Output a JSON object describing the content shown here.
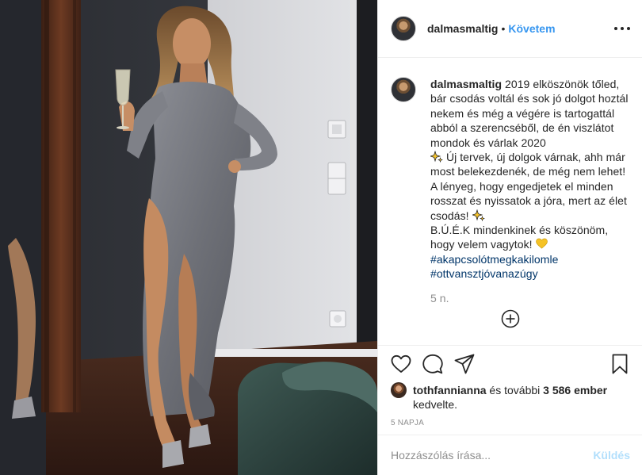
{
  "post": {
    "username": "dalmasmaltig",
    "follow_label": "Követem",
    "separator": "•"
  },
  "caption": {
    "username": "dalmasmaltig",
    "text_1": "2019 elköszönök tőled, bár csodás voltál és sok jó dolgot hoztál nekem és még a végére is tartogattál abból a szerencséből, de én viszlátot mondok és várlak 2020",
    "text_2": " Új tervek, új dolgok várnak, ahh már most belekezdenék, de még nem lehet! A lényeg, hogy engedjetek el minden rosszat és nyissatok a jóra, mert az élet csodás!",
    "text_3": "B.Ú.É.K mindenkinek és köszönöm, hogy velem vagytok!",
    "hashtags": [
      "#akapcsolótmegkakilomle",
      "#ottvansztjóvanazúgy"
    ],
    "time_ago": "5 n."
  },
  "likes": {
    "user": "tothfannianna",
    "middle": " és további ",
    "count": "3 586 ember",
    "suffix": "kedvelte."
  },
  "date": "5 napja",
  "comment": {
    "placeholder": "Hozzászólás írása...",
    "send_label": "Küldés"
  },
  "icons": {
    "more": "more-options-icon",
    "load_more": "plus-circle-icon",
    "like": "heart-icon",
    "comment": "comment-icon",
    "share": "share-icon",
    "save": "bookmark-icon",
    "emoji_star": "sparkle-emoji",
    "emoji_heart": "yellow-heart-emoji"
  },
  "colors": {
    "link": "#3897f0",
    "hashtag": "#003569",
    "muted": "#8e8e8e",
    "send_disabled": "#b2dffc"
  }
}
